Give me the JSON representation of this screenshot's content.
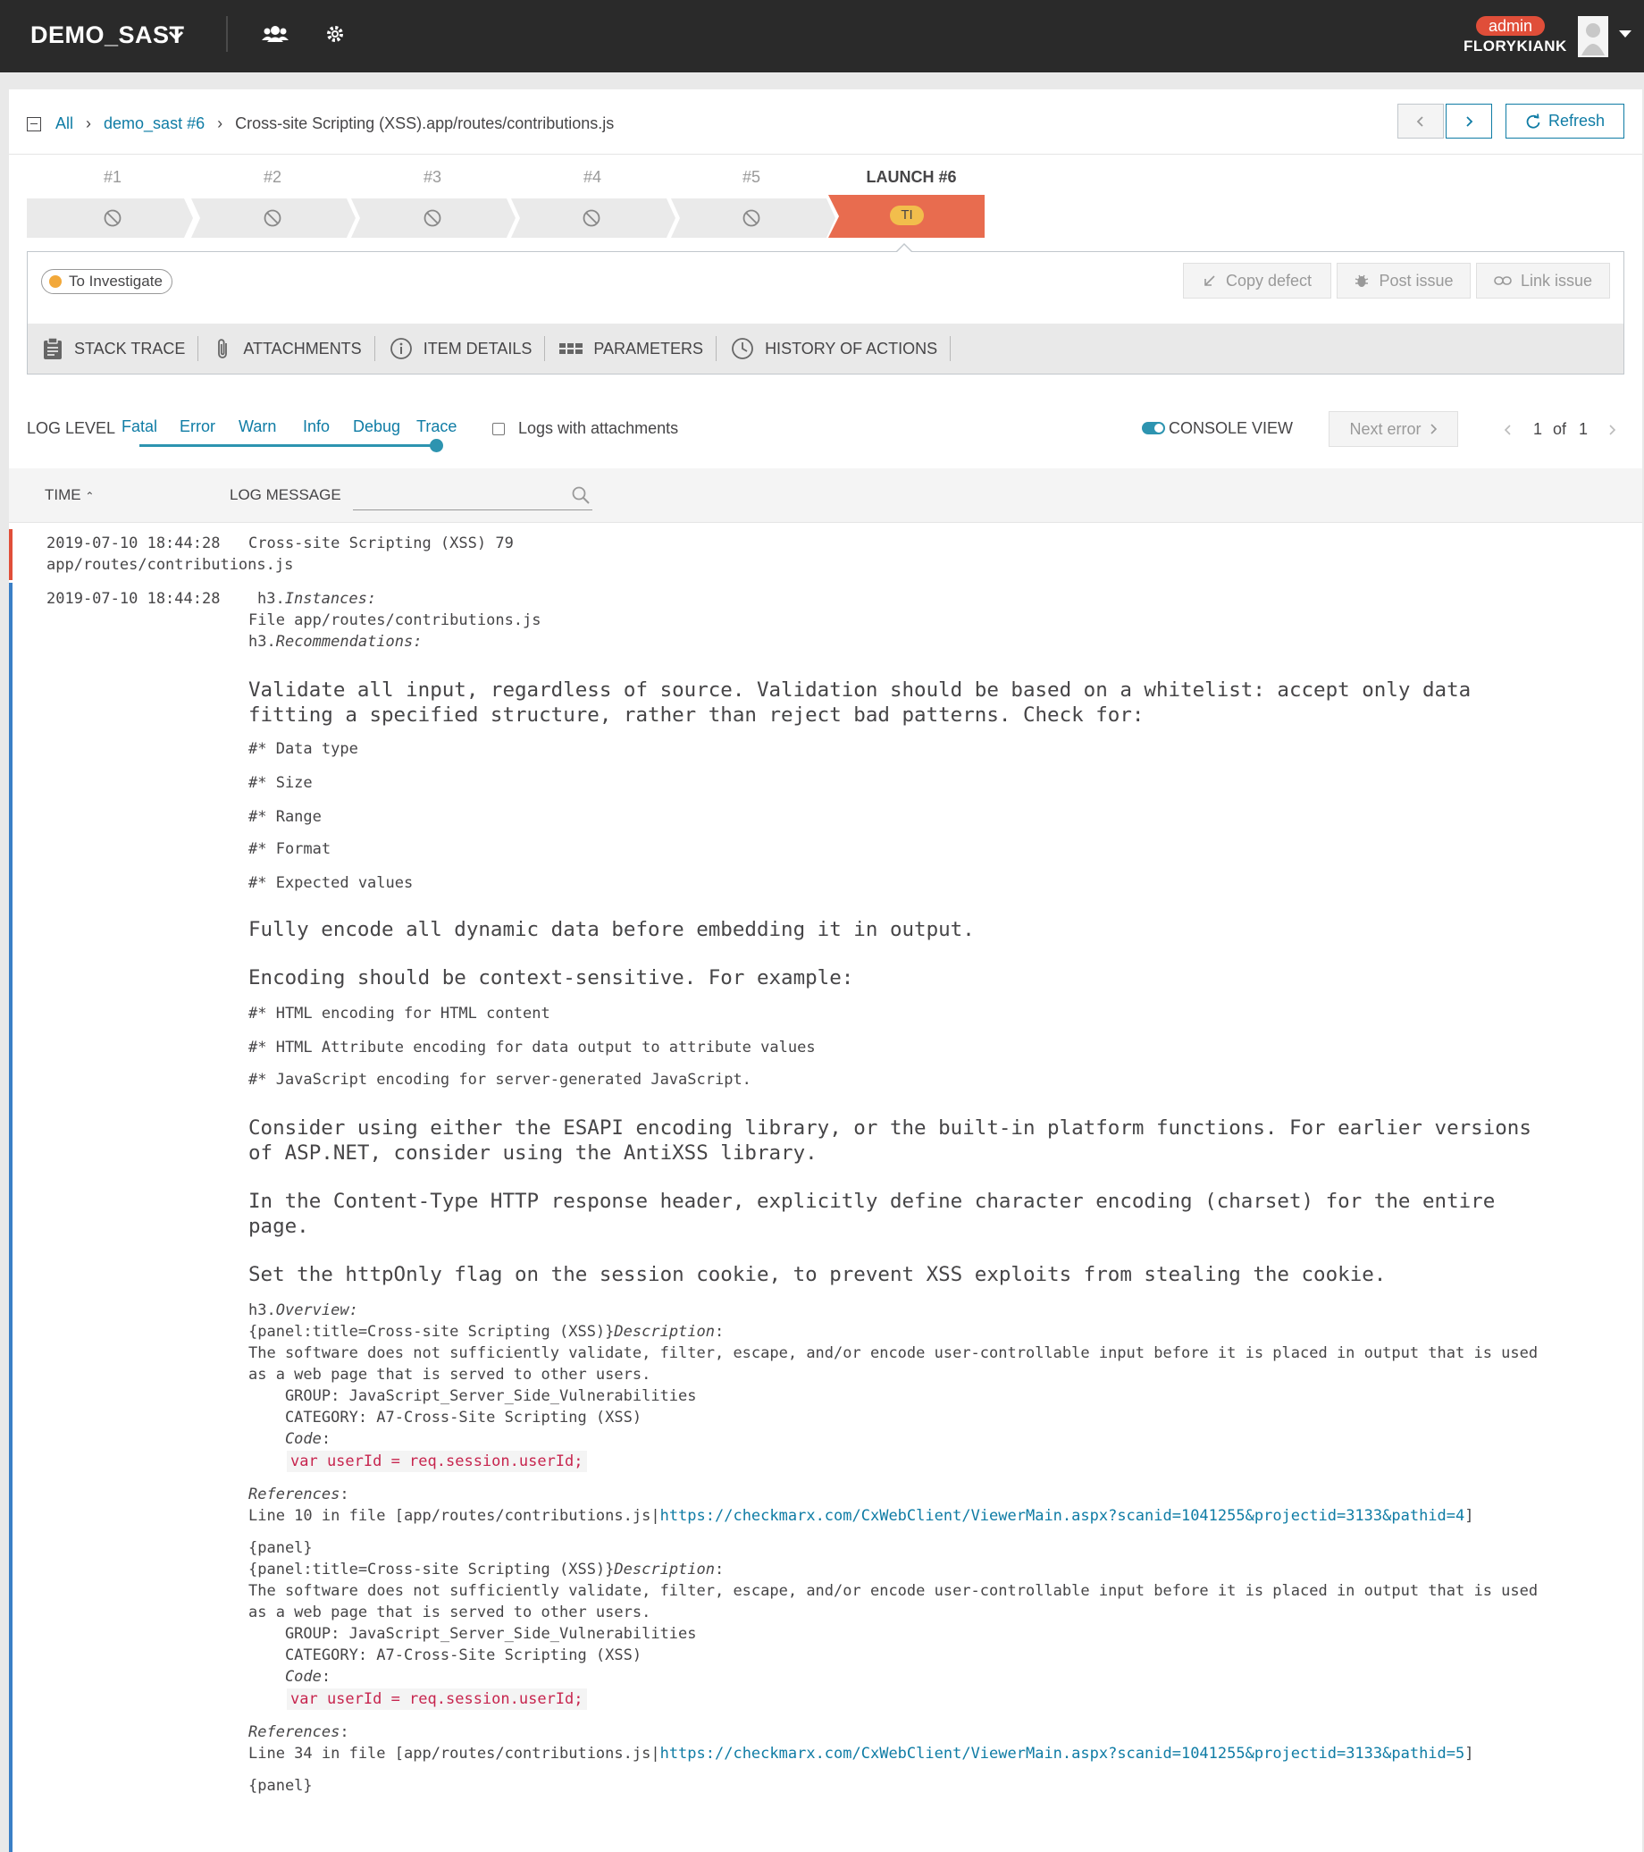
{
  "header": {
    "project": "DEMO_SAST",
    "role": "admin",
    "username": "FLORYKIANK"
  },
  "breadcrumb": {
    "all": "All",
    "launch": "demo_sast #6",
    "item": "Cross-site Scripting (XSS).app/routes/contributions.js"
  },
  "toolbar": {
    "refresh": "Refresh"
  },
  "launches": {
    "labels": [
      "#1",
      "#2",
      "#3",
      "#4",
      "#5",
      "LAUNCH #6"
    ],
    "current_badge": "TI"
  },
  "defect": {
    "status": "To Investigate",
    "copy_defect": "Copy defect",
    "post_issue": "Post issue",
    "link_issue": "Link issue"
  },
  "tabs": [
    "STACK TRACE",
    "ATTACHMENTS",
    "ITEM DETAILS",
    "PARAMETERS",
    "HISTORY OF ACTIONS"
  ],
  "log_filter": {
    "label": "LOG LEVEL",
    "levels": [
      "Fatal",
      "Error",
      "Warn",
      "Info",
      "Debug",
      "Trace"
    ],
    "attachments_label": "Logs with attachments",
    "console_view": "CONSOLE VIEW",
    "next_error": "Next error",
    "page_current": "1",
    "page_of": "of",
    "page_total": "1"
  },
  "table": {
    "time_header": "TIME",
    "message_header": "LOG MESSAGE"
  },
  "log": {
    "entry1_time": "2019-07-10 18:44:28",
    "entry1_msg": "Cross-site Scripting (XSS) 79",
    "entry1_file": "app/routes/contributions.js",
    "entry2_time": "2019-07-10 18:44:28",
    "h3": "h3.",
    "instances": "Instances:",
    "file_line": "File app/routes/contributions.js",
    "recommendations": "Recommendations:",
    "validate_1": "Validate all input, regardless of source. Validation should be based on a whitelist: accept only data",
    "validate_2": "fitting a specified structure, rather than reject bad patterns. Check for:",
    "checks": [
      "#* Data type",
      "#* Size",
      "#* Range",
      "#* Format",
      "#* Expected values"
    ],
    "encode_all": "Fully encode all dynamic data before embedding it in output.",
    "encoding_ctx": "Encoding should be context-sensitive. For example:",
    "encodings": [
      "#* HTML encoding for HTML content",
      "#* HTML Attribute encoding for data output to attribute values",
      "#* JavaScript encoding for server-generated JavaScript."
    ],
    "consider_1": "Consider using either the ESAPI encoding library, or the built-in platform functions. For earlier versions",
    "consider_2": "of ASP.NET, consider using the AntiXSS library.",
    "content_type_1": "In the Content-Type HTTP response header, explicitly define character encoding (charset) for the entire",
    "content_type_2": "page.",
    "httponly": "Set the httpOnly flag on the session cookie, to prevent XSS exploits from stealing the cookie.",
    "overview": "Overview:",
    "panel_title": "{panel:title=Cross-site Scripting (XSS)}",
    "description": "Description",
    "colon": ":",
    "desc_1": "The software does not sufficiently validate, filter, escape, and/or encode user-controllable input before it is placed in output that is used",
    "desc_2": "as a web page that is served to other users.",
    "group": "    GROUP: JavaScript_Server_Side_Vulnerabilities",
    "category": "    CATEGORY: A7-Cross-Site Scripting (XSS)",
    "code_label": "    Code",
    "code": "var userId = req.session.userId;",
    "references": "References",
    "ref1_prefix": "Line 10 in file [app/routes/contributions.js|",
    "ref1_url": "https://checkmarx.com/CxWebClient/ViewerMain.aspx?scanid=1041255&projectid=3133&pathid=4",
    "ref2_prefix": "Line 34 in file [app/routes/contributions.js|",
    "ref2_url": "https://checkmarx.com/CxWebClient/ViewerMain.aspx?scanid=1041255&projectid=3133&pathid=5",
    "bracket_close": "]",
    "panel_close": "{panel}"
  }
}
